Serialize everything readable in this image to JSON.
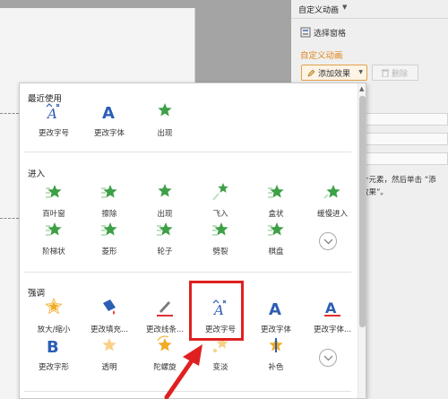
{
  "document": {},
  "task_pane": {
    "title": "自定义动画",
    "selection_pane_label": "选择窗格",
    "section_label": "自定义动画",
    "add_effect_label": "添加效果",
    "delete_label": "删除",
    "hint_line_1": "个元素，然后单击 “添",
    "hint_line_2": "效果”。"
  },
  "effects_menu": {
    "sections": [
      {
        "title": "最近使用",
        "effects": [
          {
            "label": "更改字号",
            "icon": "font-size-change-icon"
          },
          {
            "label": "更改字体",
            "icon": "font-change-icon"
          },
          {
            "label": "出现",
            "icon": "appear-star-icon"
          }
        ]
      },
      {
        "title": "进入",
        "effects": [
          {
            "label": "百叶窗",
            "icon": "blinds-star-icon"
          },
          {
            "label": "擦除",
            "icon": "wipe-star-icon"
          },
          {
            "label": "出现",
            "icon": "appear-star-icon"
          },
          {
            "label": "飞入",
            "icon": "fly-in-star-icon"
          },
          {
            "label": "盒状",
            "icon": "box-star-icon"
          },
          {
            "label": "缓慢进入",
            "icon": "crawl-in-star-icon"
          },
          {
            "label": "阶梯状",
            "icon": "stairs-star-icon"
          },
          {
            "label": "菱形",
            "icon": "diamond-star-icon"
          },
          {
            "label": "轮子",
            "icon": "wheel-star-icon"
          },
          {
            "label": "劈裂",
            "icon": "split-star-icon"
          },
          {
            "label": "棋盘",
            "icon": "checkerboard-star-icon"
          }
        ]
      },
      {
        "title": "强调",
        "effects": [
          {
            "label": "放大/缩小",
            "icon": "grow-shrink-star-icon"
          },
          {
            "label": "更改填充...",
            "icon": "change-fill-icon"
          },
          {
            "label": "更改线条...",
            "icon": "change-line-icon"
          },
          {
            "label": "更改字号",
            "icon": "font-size-change-icon"
          },
          {
            "label": "更改字体",
            "icon": "font-change-icon"
          },
          {
            "label": "更改字体...",
            "icon": "font-color-change-icon"
          },
          {
            "label": "更改字形",
            "icon": "font-style-change-icon"
          },
          {
            "label": "透明",
            "icon": "transparency-star-icon"
          },
          {
            "label": "陀螺旋",
            "icon": "spin-star-icon"
          },
          {
            "label": "变淡",
            "icon": "fade-star-icon"
          },
          {
            "label": "补色",
            "icon": "complementary-color-star-icon"
          }
        ]
      }
    ]
  },
  "colors": {
    "accent_orange": "#e0851d",
    "entrance_green": "#3da047",
    "emphasis_gold": "#f2ab24",
    "text_blue": "#2b5fb4",
    "annotation_red": "#e02020"
  }
}
